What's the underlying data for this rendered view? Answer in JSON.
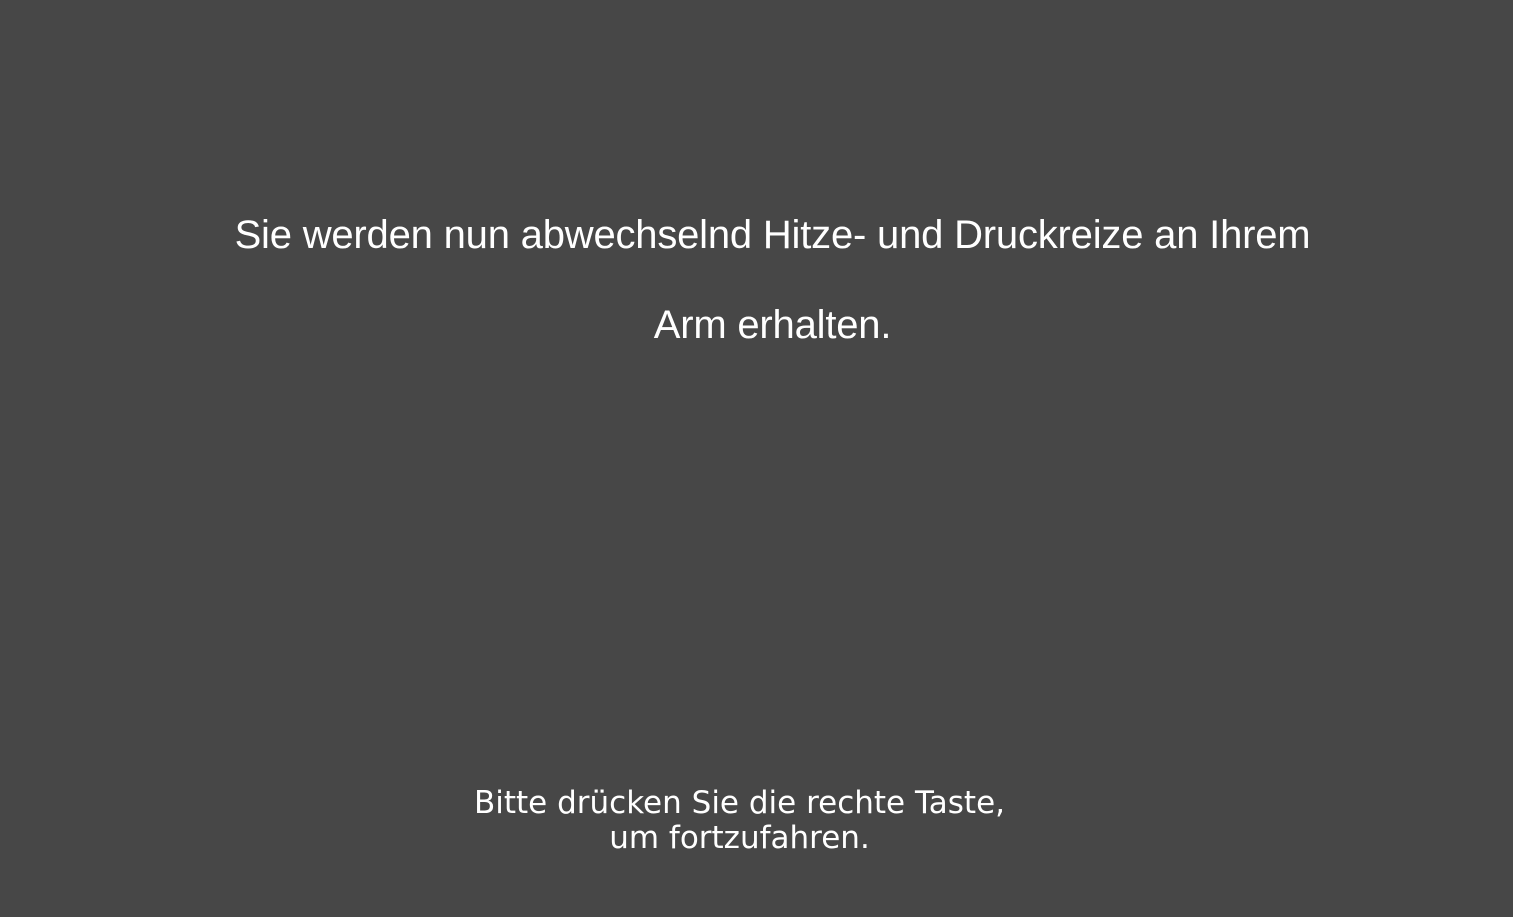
{
  "instruction": {
    "line1": "Sie werden nun abwechselnd Hitze- und Druckreize an Ihrem",
    "line2": "Arm erhalten."
  },
  "continue_prompt": {
    "line1": "Bitte drücken Sie die rechte Taste,",
    "line2": "um fortzufahren."
  },
  "colors": {
    "background": "#474747",
    "text": "#ffffff"
  }
}
